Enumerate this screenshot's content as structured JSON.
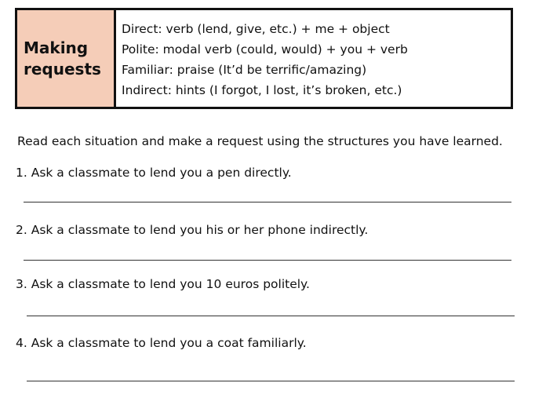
{
  "summary": {
    "title_line1": "Making",
    "title_line2": "requests",
    "lines": [
      "Direct: verb (lend, give, etc.) + me + object",
      "Polite: modal verb (could, would) + you + verb",
      "Familiar: praise (It’d be terrific/amazing)",
      "Indirect: hints (I forgot, I lost, it’s broken, etc.)"
    ]
  },
  "instructions": "Read each situation and make a request using the structures you have learned.",
  "questions": [
    "1. Ask a classmate to lend you a pen directly.",
    "2. Ask a classmate to lend you his or her phone indirectly.",
    "3. Ask a classmate to lend you 10 euros politely.",
    "4. Ask a classmate to lend you a coat familiarly."
  ],
  "colors": {
    "title_cell_background": "#f5cdb8",
    "border": "#111111"
  }
}
